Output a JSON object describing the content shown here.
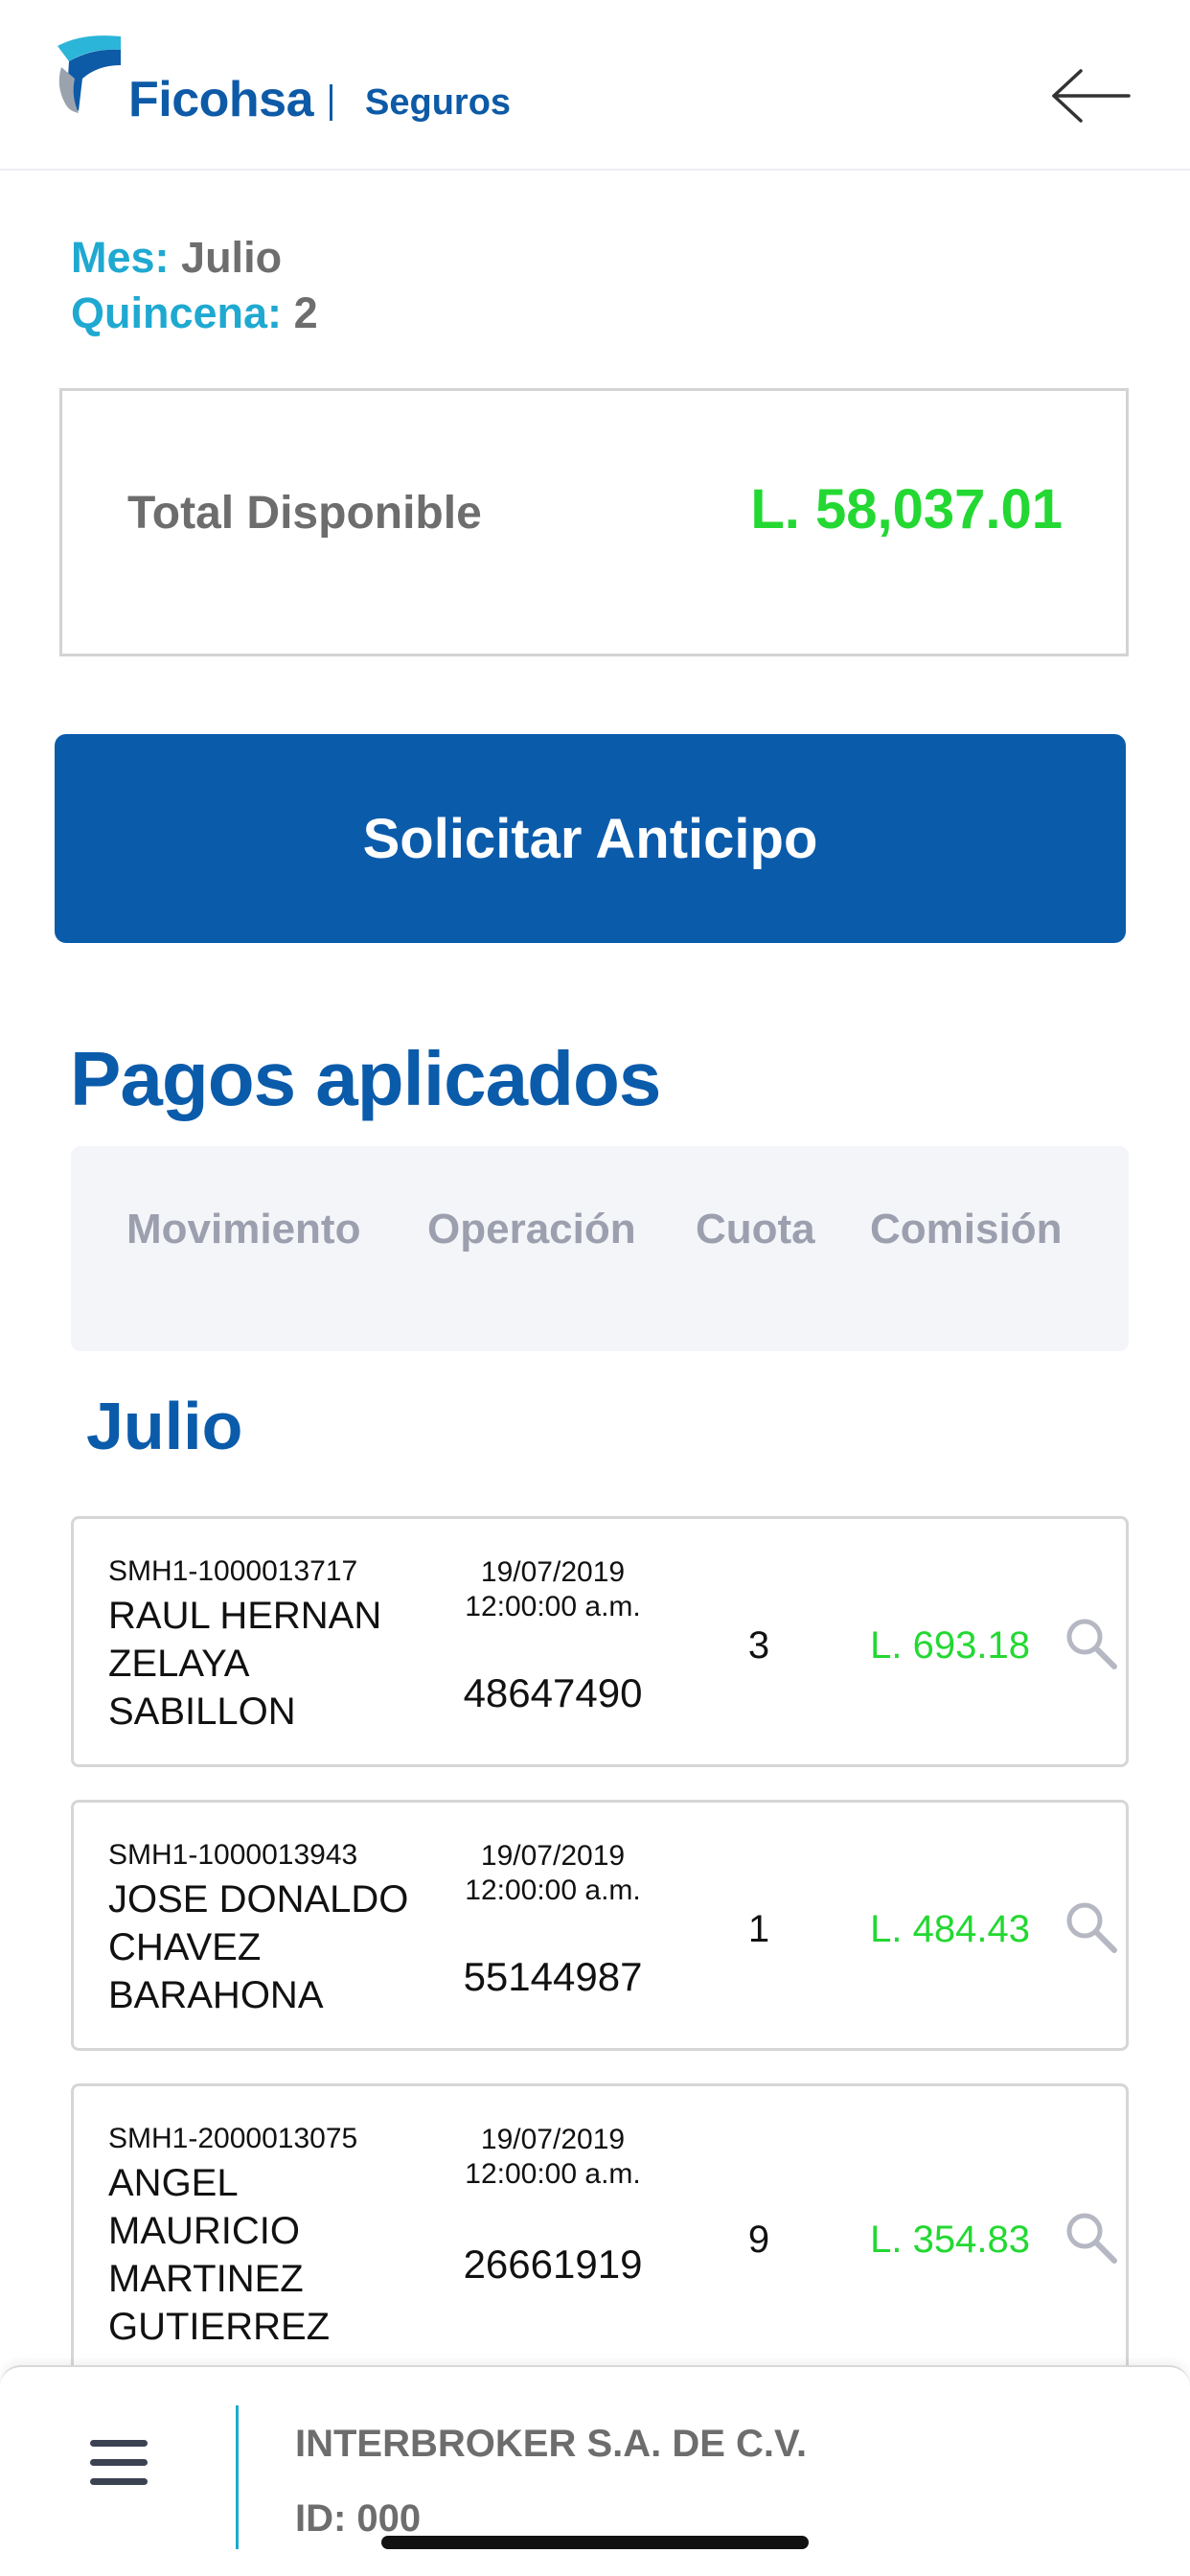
{
  "header": {
    "brand": "Ficohsa",
    "sub_brand": "Seguros",
    "back_icon": "arrow-left-icon"
  },
  "period": {
    "month_label": "Mes:",
    "month_value": "Julio",
    "fortnight_label": "Quincena:",
    "fortnight_value": "2"
  },
  "total": {
    "label": "Total Disponible",
    "amount": "L. 58,037.01"
  },
  "cta": {
    "label": "Solicitar Anticipo"
  },
  "payments": {
    "title": "Pagos aplicados",
    "columns": [
      "Movimiento",
      "Operación",
      "Cuota",
      "Comisión"
    ],
    "month": "Julio",
    "rows": [
      {
        "code": "SMH1-1000013717",
        "name": "RAUL HERNAN ZELAYA SABILLON",
        "date": "19/07/2019",
        "time": "12:00:00 a.m.",
        "operation": "48647490",
        "cuota": "3",
        "commission": "L. 693.18"
      },
      {
        "code": "SMH1-1000013943",
        "name": "JOSE DONALDO CHAVEZ BARAHONA",
        "date": "19/07/2019",
        "time": "12:00:00 a.m.",
        "operation": "55144987",
        "cuota": "1",
        "commission": "L. 484.43"
      },
      {
        "code": "SMH1-2000013075",
        "name": "ANGEL MAURICIO MARTINEZ GUTIERREZ",
        "date": "19/07/2019",
        "time": "12:00:00 a.m.",
        "operation": "26661919",
        "cuota": "9",
        "commission": "L. 354.83"
      }
    ]
  },
  "footer": {
    "menu_icon": "hamburger-menu-icon",
    "company": "INTERBROKER S.A. DE C.V.",
    "id": "ID: 000"
  },
  "colors": {
    "primary": "#0b5bab",
    "accent": "#1fa9d1",
    "positive": "#23d832",
    "muted": "#6d6d6d"
  }
}
